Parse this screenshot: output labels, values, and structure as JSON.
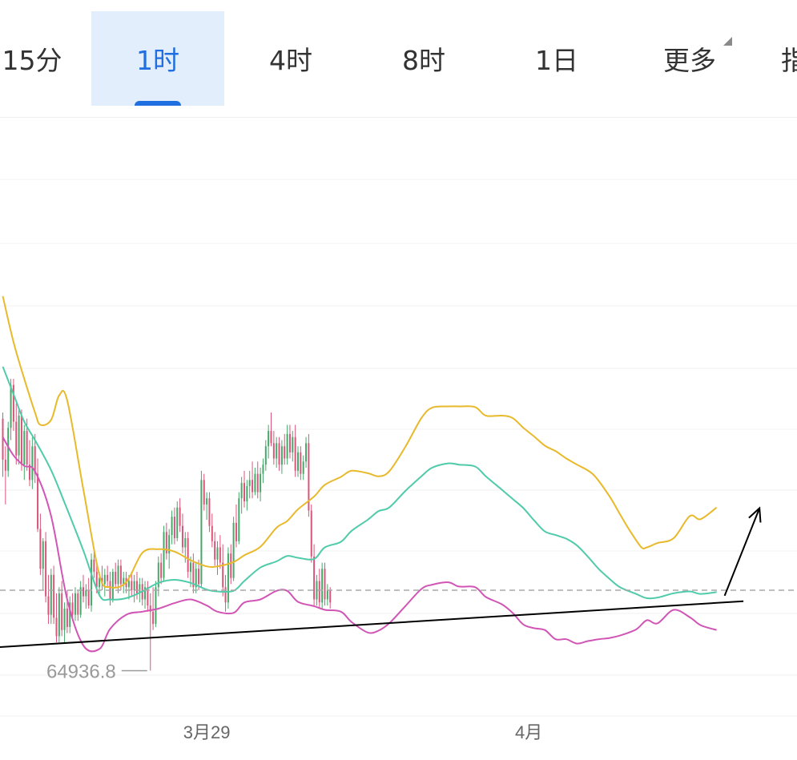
{
  "tabs": [
    {
      "id": "15m",
      "label": "15分",
      "active": false
    },
    {
      "id": "1h",
      "label": "1时",
      "active": true
    },
    {
      "id": "4h",
      "label": "4时",
      "active": false
    },
    {
      "id": "8h",
      "label": "8时",
      "active": false
    },
    {
      "id": "1d",
      "label": "1日",
      "active": false
    },
    {
      "id": "more",
      "label": "更多",
      "active": false
    },
    {
      "id": "cut",
      "label": "指",
      "active": false
    }
  ],
  "colors": {
    "up": "#47a86a",
    "down": "#d9567b",
    "upper_band": "#e8b92a",
    "middle_band": "#4fcbaa",
    "lower_band": "#d155b5",
    "trendline": "#000000",
    "price_line": "#a9a9a9",
    "min_label": "#999999",
    "accent": "#1f6fe0"
  },
  "chart_data": {
    "type": "candlestick",
    "indicator": "bollinger_bands",
    "x_tick_labels": [
      "3月29",
      "4月"
    ],
    "min_label": "64936.8",
    "candles_ohlc": [
      [
        69050,
        69150,
        68100,
        68380
      ],
      [
        68380,
        68600,
        67650,
        68200
      ],
      [
        68200,
        69000,
        68100,
        68900
      ],
      [
        68900,
        69700,
        68700,
        69600
      ],
      [
        69600,
        69700,
        68850,
        69000
      ],
      [
        69000,
        69300,
        68300,
        68450
      ],
      [
        68450,
        69200,
        68300,
        69100
      ],
      [
        69100,
        69200,
        68200,
        68300
      ],
      [
        68300,
        68950,
        68050,
        68850
      ],
      [
        68850,
        69050,
        68200,
        68300
      ],
      [
        68300,
        68700,
        67950,
        68050
      ],
      [
        68050,
        68750,
        67900,
        68600
      ],
      [
        68600,
        68800,
        68000,
        68150
      ],
      [
        68150,
        68400,
        67200,
        67250
      ],
      [
        67250,
        67500,
        66500,
        66600
      ],
      [
        66600,
        67100,
        66250,
        67050
      ],
      [
        67050,
        67200,
        66050,
        66150
      ],
      [
        66150,
        66500,
        65700,
        65850
      ],
      [
        65850,
        66600,
        65700,
        66500
      ],
      [
        66500,
        66650,
        65700,
        65800
      ],
      [
        65800,
        66200,
        65400,
        65500
      ],
      [
        65500,
        66300,
        65400,
        66200
      ],
      [
        66200,
        66400,
        65500,
        65600
      ],
      [
        65600,
        66050,
        65400,
        65950
      ],
      [
        65950,
        66250,
        65550,
        65650
      ],
      [
        65650,
        66150,
        65550,
        66050
      ],
      [
        66050,
        66200,
        65750,
        65850
      ],
      [
        65850,
        66300,
        65750,
        66200
      ],
      [
        66200,
        66250,
        65750,
        65850
      ],
      [
        65850,
        66400,
        65800,
        66300
      ],
      [
        66300,
        66500,
        66050,
        66150
      ],
      [
        66150,
        66350,
        65950,
        66250
      ],
      [
        66250,
        66450,
        65950,
        66000
      ],
      [
        66000,
        66850,
        65900,
        66750
      ],
      [
        66750,
        66950,
        66450,
        66550
      ],
      [
        66550,
        66700,
        66200,
        66300
      ],
      [
        66300,
        66550,
        66150,
        66450
      ],
      [
        66450,
        66650,
        66250,
        66350
      ],
      [
        66350,
        66600,
        66150,
        66500
      ],
      [
        66500,
        66650,
        66300,
        66400
      ],
      [
        66400,
        66550,
        66000,
        66100
      ],
      [
        66100,
        66600,
        66050,
        66550
      ],
      [
        66550,
        66700,
        66300,
        66350
      ],
      [
        66350,
        66750,
        66200,
        66650
      ],
      [
        66650,
        66750,
        66250,
        66350
      ],
      [
        66350,
        66550,
        66200,
        66450
      ],
      [
        66450,
        66550,
        66200,
        66300
      ],
      [
        66300,
        66500,
        66100,
        66400
      ],
      [
        66400,
        66550,
        66150,
        66250
      ],
      [
        66250,
        66500,
        66050,
        66400
      ],
      [
        66400,
        66550,
        66100,
        66200
      ],
      [
        66200,
        66450,
        66050,
        66350
      ],
      [
        66350,
        66450,
        66000,
        66100
      ],
      [
        66100,
        66400,
        65950,
        66300
      ],
      [
        66300,
        66400,
        65900,
        66000
      ],
      [
        66000,
        66200,
        64936.8,
        65900
      ],
      [
        65900,
        66300,
        65600,
        65700
      ],
      [
        65700,
        66400,
        65650,
        66300
      ],
      [
        66300,
        66800,
        66150,
        66700
      ],
      [
        66700,
        66850,
        66350,
        66450
      ],
      [
        66450,
        67300,
        66400,
        67200
      ],
      [
        67200,
        67350,
        66750,
        66850
      ],
      [
        66850,
        67250,
        66600,
        67150
      ],
      [
        67150,
        67550,
        67000,
        67450
      ],
      [
        67450,
        67600,
        67000,
        67100
      ],
      [
        67100,
        67700,
        67050,
        67600
      ],
      [
        67600,
        67750,
        67200,
        67300
      ],
      [
        67300,
        67500,
        66850,
        66950
      ],
      [
        66950,
        67200,
        66700,
        67100
      ],
      [
        67100,
        67200,
        66450,
        66550
      ],
      [
        66550,
        66800,
        66300,
        66700
      ],
      [
        66700,
        66850,
        66200,
        66300
      ],
      [
        66300,
        66700,
        66200,
        66600
      ],
      [
        66600,
        66750,
        66250,
        66350
      ],
      [
        66350,
        68200,
        66300,
        68050
      ],
      [
        68050,
        68150,
        67550,
        67650
      ],
      [
        67650,
        67850,
        67400,
        67750
      ],
      [
        67750,
        67850,
        67200,
        67300
      ],
      [
        67300,
        67500,
        66950,
        67050
      ],
      [
        67050,
        67200,
        66650,
        66750
      ],
      [
        66750,
        67050,
        66500,
        66950
      ],
      [
        66950,
        67150,
        66600,
        66700
      ],
      [
        66700,
        67000,
        66150,
        66300
      ],
      [
        66300,
        66500,
        65900,
        66050
      ],
      [
        66050,
        66950,
        65950,
        66850
      ],
      [
        66850,
        67000,
        66350,
        66450
      ],
      [
        66450,
        67450,
        66400,
        67350
      ],
      [
        67350,
        67650,
        66950,
        67050
      ],
      [
        67050,
        67850,
        67000,
        67750
      ],
      [
        67750,
        68100,
        67500,
        68000
      ],
      [
        68000,
        68200,
        67600,
        67700
      ],
      [
        67700,
        68050,
        67550,
        67950
      ],
      [
        67950,
        68200,
        67750,
        68050
      ],
      [
        68050,
        68350,
        67750,
        67850
      ],
      [
        67850,
        68250,
        67800,
        68150
      ],
      [
        68150,
        68350,
        67750,
        67850
      ],
      [
        67850,
        68250,
        67700,
        68150
      ],
      [
        68150,
        68400,
        68000,
        68300
      ],
      [
        68300,
        68700,
        68200,
        68600
      ],
      [
        68600,
        68950,
        68400,
        68850
      ],
      [
        68850,
        69150,
        68600,
        68650
      ],
      [
        68650,
        68850,
        68300,
        68400
      ],
      [
        68400,
        68750,
        68250,
        68650
      ],
      [
        68650,
        68750,
        68200,
        68300
      ],
      [
        68300,
        68700,
        68150,
        68600
      ],
      [
        68600,
        68800,
        68300,
        68400
      ],
      [
        68400,
        68950,
        68300,
        68800
      ],
      [
        68800,
        68950,
        68400,
        68500
      ],
      [
        68500,
        68850,
        68350,
        68750
      ],
      [
        68750,
        68950,
        68100,
        68200
      ],
      [
        68200,
        68600,
        68100,
        68500
      ],
      [
        68500,
        68600,
        68050,
        68150
      ],
      [
        68150,
        68450,
        68050,
        68350
      ],
      [
        68350,
        68750,
        68250,
        68650
      ],
      [
        68650,
        68800,
        67450,
        67550
      ],
      [
        67550,
        67650,
        66700,
        66800
      ],
      [
        66800,
        67000,
        66000,
        66100
      ],
      [
        66100,
        66500,
        66000,
        66400
      ],
      [
        66400,
        66600,
        65950,
        66050
      ],
      [
        66050,
        66700,
        65950,
        66600
      ],
      [
        66600,
        66700,
        66000,
        66100
      ],
      [
        66100,
        66350,
        66000,
        66250
      ],
      [
        66250,
        66300,
        65950,
        66050
      ]
    ],
    "upper_band": [
      [
        0,
        71050
      ],
      [
        4,
        70300
      ],
      [
        8,
        69700
      ],
      [
        12,
        69150
      ],
      [
        14,
        68950
      ],
      [
        18,
        69030
      ],
      [
        21,
        69430
      ],
      [
        24,
        69350
      ],
      [
        30,
        67900
      ],
      [
        36,
        66500
      ],
      [
        40,
        66300
      ],
      [
        46,
        66380
      ],
      [
        52,
        66860
      ],
      [
        58,
        66920
      ],
      [
        64,
        66880
      ],
      [
        70,
        66740
      ],
      [
        76,
        66640
      ],
      [
        80,
        66640
      ],
      [
        86,
        66710
      ],
      [
        90,
        66820
      ],
      [
        96,
        66960
      ],
      [
        102,
        67270
      ],
      [
        106,
        67380
      ],
      [
        110,
        67570
      ],
      [
        116,
        67780
      ],
      [
        120,
        67970
      ],
      [
        126,
        68100
      ],
      [
        130,
        68200
      ],
      [
        136,
        68160
      ],
      [
        140,
        68110
      ],
      [
        144,
        68190
      ],
      [
        150,
        68590
      ],
      [
        156,
        69060
      ],
      [
        160,
        69230
      ],
      [
        166,
        69250
      ],
      [
        170,
        69250
      ],
      [
        176,
        69240
      ],
      [
        180,
        69100
      ],
      [
        186,
        69100
      ],
      [
        190,
        69060
      ],
      [
        194,
        68900
      ],
      [
        198,
        68760
      ],
      [
        202,
        68610
      ],
      [
        206,
        68520
      ],
      [
        210,
        68400
      ],
      [
        214,
        68300
      ],
      [
        220,
        68140
      ],
      [
        226,
        67790
      ],
      [
        230,
        67490
      ],
      [
        234,
        67200
      ],
      [
        238,
        66950
      ],
      [
        240,
        66950
      ],
      [
        244,
        67020
      ],
      [
        250,
        67100
      ],
      [
        256,
        67460
      ],
      [
        260,
        67410
      ],
      [
        266,
        67600
      ]
    ],
    "middle_band": [
      [
        0,
        69900
      ],
      [
        4,
        69450
      ],
      [
        8,
        69000
      ],
      [
        12,
        68700
      ],
      [
        18,
        68210
      ],
      [
        24,
        67570
      ],
      [
        30,
        66900
      ],
      [
        36,
        66170
      ],
      [
        40,
        66100
      ],
      [
        46,
        66120
      ],
      [
        52,
        66230
      ],
      [
        58,
        66370
      ],
      [
        64,
        66420
      ],
      [
        70,
        66370
      ],
      [
        76,
        66260
      ],
      [
        80,
        66230
      ],
      [
        86,
        66240
      ],
      [
        90,
        66400
      ],
      [
        96,
        66620
      ],
      [
        102,
        66720
      ],
      [
        106,
        66810
      ],
      [
        110,
        66780
      ],
      [
        116,
        66760
      ],
      [
        120,
        66950
      ],
      [
        126,
        67040
      ],
      [
        130,
        67220
      ],
      [
        136,
        67400
      ],
      [
        140,
        67540
      ],
      [
        144,
        67600
      ],
      [
        150,
        67870
      ],
      [
        156,
        68110
      ],
      [
        160,
        68250
      ],
      [
        166,
        68320
      ],
      [
        170,
        68300
      ],
      [
        176,
        68270
      ],
      [
        180,
        68110
      ],
      [
        186,
        67890
      ],
      [
        190,
        67740
      ],
      [
        194,
        67590
      ],
      [
        198,
        67390
      ],
      [
        202,
        67210
      ],
      [
        206,
        67150
      ],
      [
        210,
        67090
      ],
      [
        214,
        66980
      ],
      [
        218,
        66800
      ],
      [
        222,
        66600
      ],
      [
        226,
        66440
      ],
      [
        230,
        66300
      ],
      [
        236,
        66190
      ],
      [
        240,
        66120
      ],
      [
        244,
        66130
      ],
      [
        250,
        66200
      ],
      [
        256,
        66230
      ],
      [
        260,
        66190
      ],
      [
        266,
        66220
      ]
    ],
    "lower_band": [
      [
        0,
        68750
      ],
      [
        4,
        68450
      ],
      [
        8,
        68280
      ],
      [
        12,
        68190
      ],
      [
        18,
        67460
      ],
      [
        24,
        66100
      ],
      [
        30,
        65350
      ],
      [
        36,
        65290
      ],
      [
        40,
        65620
      ],
      [
        46,
        65850
      ],
      [
        52,
        65900
      ],
      [
        58,
        65950
      ],
      [
        64,
        66040
      ],
      [
        70,
        66100
      ],
      [
        76,
        66000
      ],
      [
        80,
        65900
      ],
      [
        86,
        65880
      ],
      [
        90,
        66050
      ],
      [
        96,
        66100
      ],
      [
        102,
        66240
      ],
      [
        106,
        66240
      ],
      [
        110,
        66060
      ],
      [
        116,
        65990
      ],
      [
        120,
        65930
      ],
      [
        126,
        65900
      ],
      [
        130,
        65730
      ],
      [
        136,
        65560
      ],
      [
        140,
        65590
      ],
      [
        144,
        65710
      ],
      [
        150,
        65990
      ],
      [
        156,
        66270
      ],
      [
        160,
        66340
      ],
      [
        166,
        66380
      ],
      [
        170,
        66310
      ],
      [
        176,
        66300
      ],
      [
        180,
        66140
      ],
      [
        186,
        66020
      ],
      [
        190,
        65880
      ],
      [
        194,
        65690
      ],
      [
        198,
        65630
      ],
      [
        202,
        65600
      ],
      [
        206,
        65450
      ],
      [
        210,
        65450
      ],
      [
        214,
        65380
      ],
      [
        218,
        65420
      ],
      [
        222,
        65450
      ],
      [
        226,
        65470
      ],
      [
        230,
        65510
      ],
      [
        236,
        65610
      ],
      [
        240,
        65760
      ],
      [
        244,
        65710
      ],
      [
        250,
        65930
      ],
      [
        256,
        65810
      ],
      [
        260,
        65680
      ],
      [
        266,
        65600
      ]
    ],
    "trendline": [
      [
        -2,
        65320
      ],
      [
        276,
        66070
      ]
    ],
    "arrow": [
      [
        269,
        66160
      ],
      [
        282,
        67590
      ]
    ],
    "last_price": 66250
  }
}
